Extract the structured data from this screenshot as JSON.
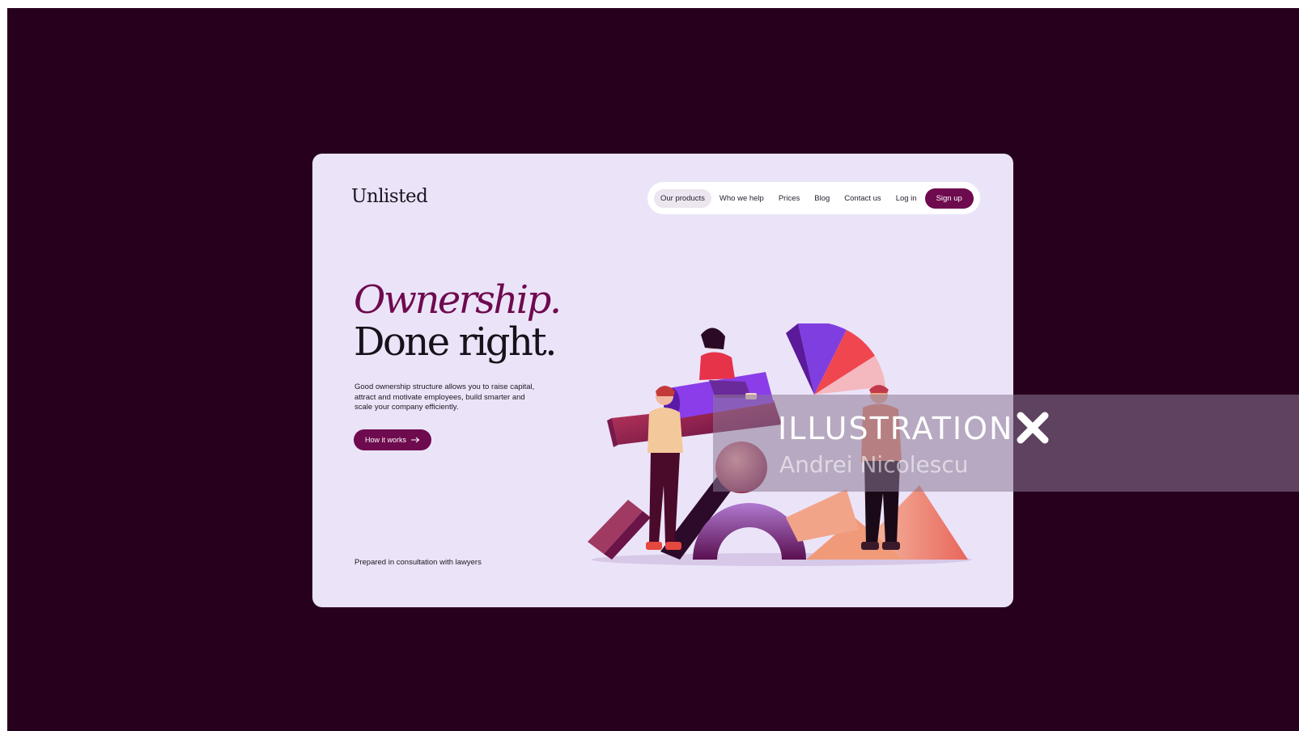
{
  "brand": {
    "logo": "Unlisted"
  },
  "nav": {
    "items": [
      "Our products",
      "Who we help",
      "Prices",
      "Blog",
      "Contact us",
      "Log in"
    ],
    "active": "Our products",
    "signup": "Sign up"
  },
  "hero": {
    "headline_italic": "Ownership.",
    "headline": "Done right.",
    "description": "Good ownership structure allows you to raise capital, attract and motivate employees, build smarter and scale your company efficiently.",
    "cta": "How it works",
    "cta_icon": "arrow-right-icon"
  },
  "footer_note": "Prepared in consultation with lawyers",
  "watermark": {
    "title": "ILLUSTRATION",
    "mark": "X",
    "artist": "Andrei Nicolescu"
  },
  "colors": {
    "backdrop": "#27001d",
    "card": "#ebe4f9",
    "accent": "#6e0a4e"
  }
}
